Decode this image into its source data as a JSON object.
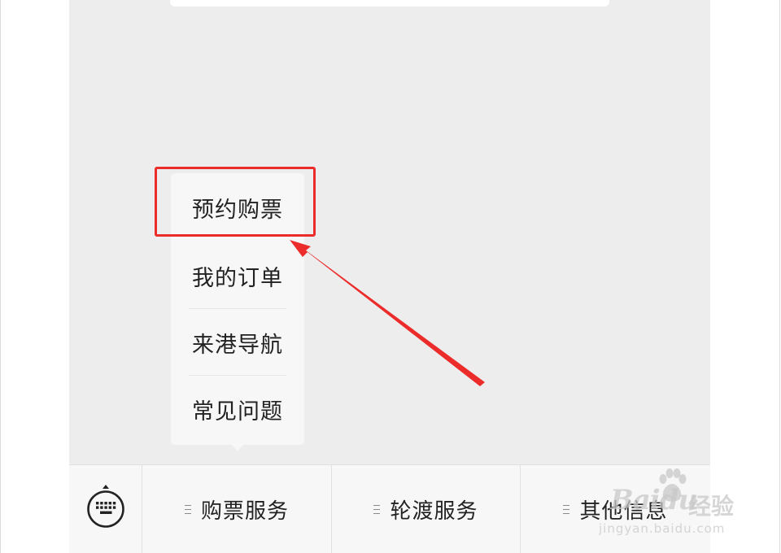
{
  "popup_menu": {
    "items": [
      {
        "label": "预约购票"
      },
      {
        "label": "我的订单"
      },
      {
        "label": "来港导航"
      },
      {
        "label": "常见问题"
      }
    ]
  },
  "bottom_menu": {
    "keyboard_icon": "keyboard-icon",
    "tabs": [
      {
        "label": "购票服务",
        "icon": "menu-list-icon"
      },
      {
        "label": "轮渡服务",
        "icon": "menu-list-icon"
      },
      {
        "label": "其他信息",
        "icon": "menu-list-icon"
      }
    ]
  },
  "annotation": {
    "color": "#ec2b2b"
  },
  "watermark": {
    "brand": "Baidu",
    "suffix": "经验",
    "url": "jingyan.baidu.com"
  }
}
